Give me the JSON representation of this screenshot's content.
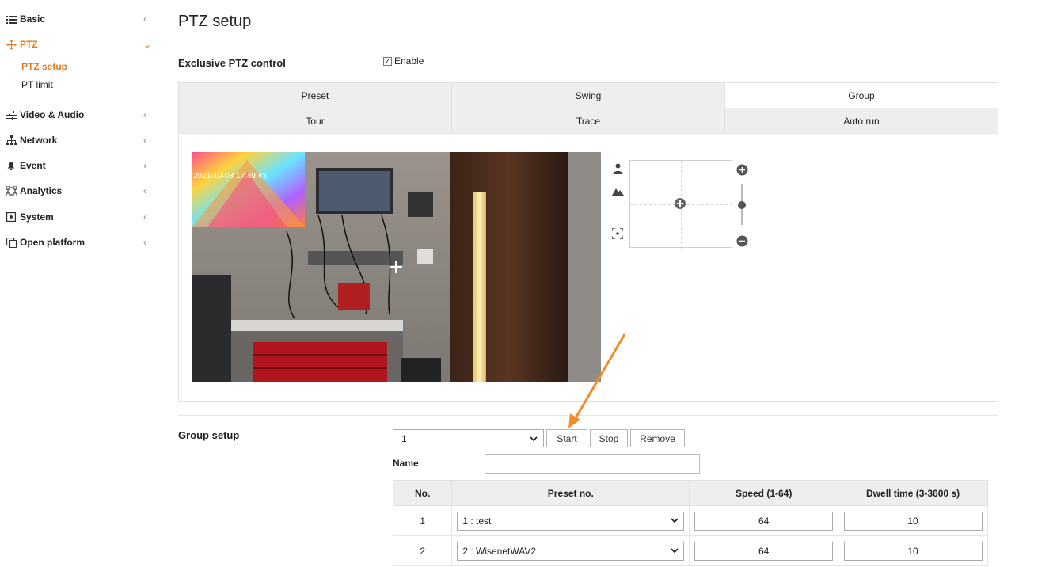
{
  "sidebar": {
    "items": [
      {
        "label": "Basic",
        "arrow": "‹",
        "icon": "list-icon"
      },
      {
        "label": "PTZ",
        "arrow": "⌄",
        "icon": "ptz-move-icon"
      },
      {
        "label": "Video & Audio",
        "arrow": "‹",
        "icon": "sliders-icon"
      },
      {
        "label": "Network",
        "arrow": "‹",
        "icon": "network-icon"
      },
      {
        "label": "Event",
        "arrow": "‹",
        "icon": "bell-icon"
      },
      {
        "label": "Analytics",
        "arrow": "‹",
        "icon": "analytics-icon"
      },
      {
        "label": "System",
        "arrow": "‹",
        "icon": "system-icon"
      },
      {
        "label": "Open platform",
        "arrow": "‹",
        "icon": "open-platform-icon"
      }
    ],
    "ptz_sub": [
      "PTZ setup",
      "PT limit"
    ]
  },
  "page": {
    "title": "PTZ setup",
    "exclusive_label": "Exclusive PTZ control",
    "enable_label": "Enable",
    "enable_check": "✓"
  },
  "tabs": {
    "row1": [
      "Preset",
      "Swing",
      "Group"
    ],
    "row2": [
      "Tour",
      "Trace",
      "Auto run"
    ],
    "selected": "Group"
  },
  "video": {
    "timestamp": "2021-10-03 17:49:43"
  },
  "group_setup": {
    "label": "Group setup",
    "selected_group": "1",
    "buttons": {
      "start": "Start",
      "stop": "Stop",
      "remove": "Remove"
    },
    "name_label": "Name",
    "name_value": "",
    "columns": [
      "No.",
      "Preset no.",
      "Speed (1-64)",
      "Dwell time (3-3600 s)"
    ],
    "rows": [
      {
        "no": "1",
        "preset": "1 : test",
        "speed": "64",
        "dwell": "10"
      },
      {
        "no": "2",
        "preset": "2 : WisenetWAV2",
        "speed": "64",
        "dwell": "10"
      }
    ]
  },
  "colors": {
    "accent": "#e07a1f",
    "annotation_arrow": "#f08c2a"
  }
}
